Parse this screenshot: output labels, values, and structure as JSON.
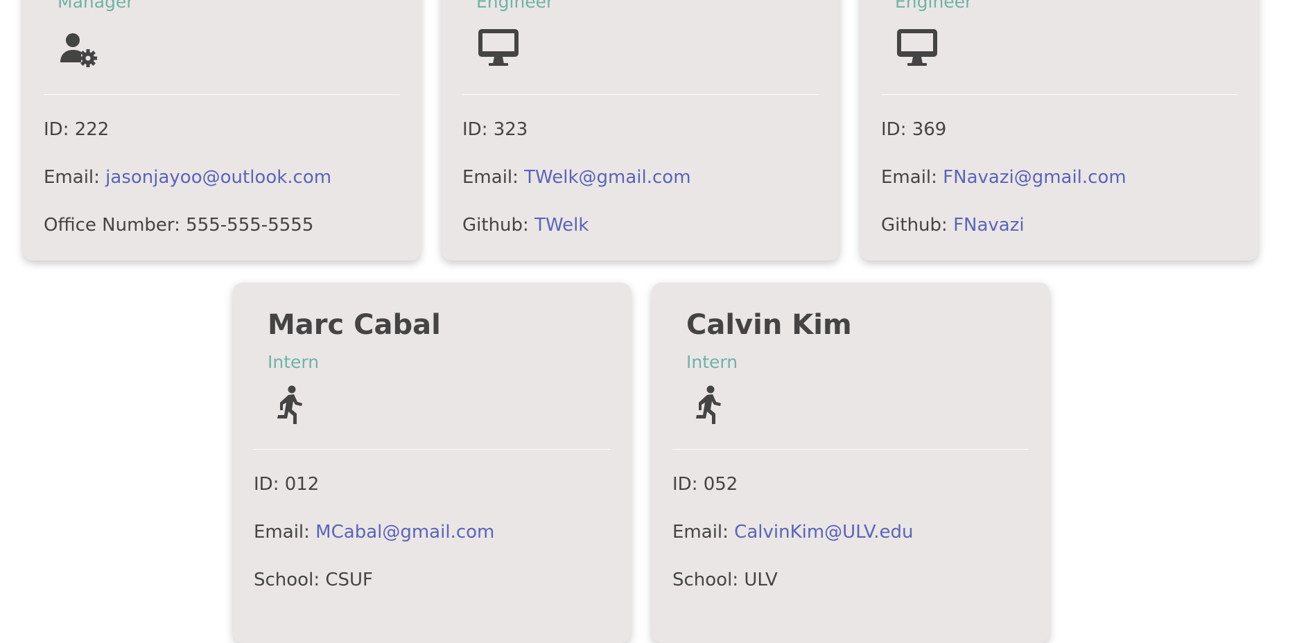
{
  "cards": [
    {
      "name": "",
      "role": "Manager",
      "icon": "user-gear-icon",
      "id_label": "ID:",
      "id_value": "222",
      "email_label": "Email:",
      "email": "jasonjayoo@outlook.com",
      "extra_label": "Office Number:",
      "extra_value": "555-555-5555"
    },
    {
      "name": "",
      "role": "Engineer",
      "icon": "desktop-monitor-icon",
      "id_label": "ID:",
      "id_value": "323",
      "email_label": "Email:",
      "email": "TWelk@gmail.com",
      "extra_label": "Github:",
      "extra_value": "TWelk"
    },
    {
      "name": "",
      "role": "Engineer",
      "icon": "desktop-monitor-icon",
      "id_label": "ID:",
      "id_value": "369",
      "email_label": "Email:",
      "email": "FNavazi@gmail.com",
      "extra_label": "Github:",
      "extra_value": "FNavazi"
    },
    {
      "name": "Marc Cabal",
      "role": "Intern",
      "icon": "running-person-icon",
      "id_label": "ID:",
      "id_value": "012",
      "email_label": "Email:",
      "email": "MCabal@gmail.com",
      "extra_label": "School:",
      "extra_value": "CSUF"
    },
    {
      "name": "Calvin Kim",
      "role": "Intern",
      "icon": "running-person-icon",
      "id_label": "ID:",
      "id_value": "052",
      "email_label": "Email:",
      "email": "CalvinKim@ULV.edu",
      "extra_label": "School:",
      "extra_value": "ULV"
    }
  ],
  "colors": {
    "card_bg": "#eae6e5",
    "role": "#6fb3a7",
    "link": "#5b64b8",
    "text": "#444444"
  }
}
